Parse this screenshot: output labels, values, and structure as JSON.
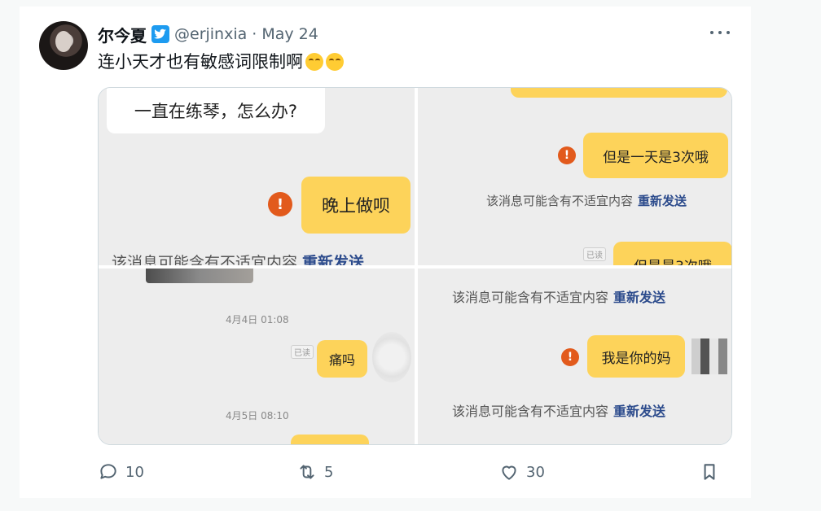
{
  "tweet": {
    "author_name": "尔今夏",
    "handle": "@erjinxia",
    "separator": "·",
    "date": "May 24",
    "text": "连小天才也有敏感词限制啊",
    "emoji_name": "face-with-tears-of-joy",
    "verified_icon": "bird-icon"
  },
  "image": {
    "panel1": {
      "incoming_text": "一直在练琴，怎么办?",
      "outgoing_text": "晚上做呗",
      "warning_mark": "!",
      "notice_text": "该消息可能含有不适宜内容",
      "resend_text": "重新发送"
    },
    "panel2": {
      "outgoing_text": "但是一天是3次哦",
      "warning_mark": "!",
      "notice_text": "该消息可能含有不适宜内容",
      "resend_text": "重新发送",
      "read_badge": "已读",
      "partial_text": "但是是3次哦"
    },
    "panel3": {
      "timestamp1": "4月4日 01:08",
      "read_badge": "已读",
      "outgoing_text": "痛吗",
      "timestamp2": "4月5日 08:10"
    },
    "panel4": {
      "notice_text": "该消息可能含有不适宜内容",
      "resend_text": "重新发送",
      "warning_mark": "!",
      "outgoing_text": "我是你的妈",
      "notice2_text": "该消息可能含有不适宜内容",
      "resend2_text": "重新发送"
    }
  },
  "actions": {
    "reply_count": "10",
    "retweet_count": "5",
    "like_count": "30",
    "reply_icon": "speech-bubble-icon",
    "retweet_icon": "retweet-arrows-icon",
    "like_icon": "heart-icon",
    "bookmark_icon": "bookmark-icon"
  },
  "colors": {
    "accent": "#1d9bf0",
    "bubble_yellow": "#fdd35a",
    "warning": "#e25a1c",
    "resend": "#2c4b8c"
  }
}
